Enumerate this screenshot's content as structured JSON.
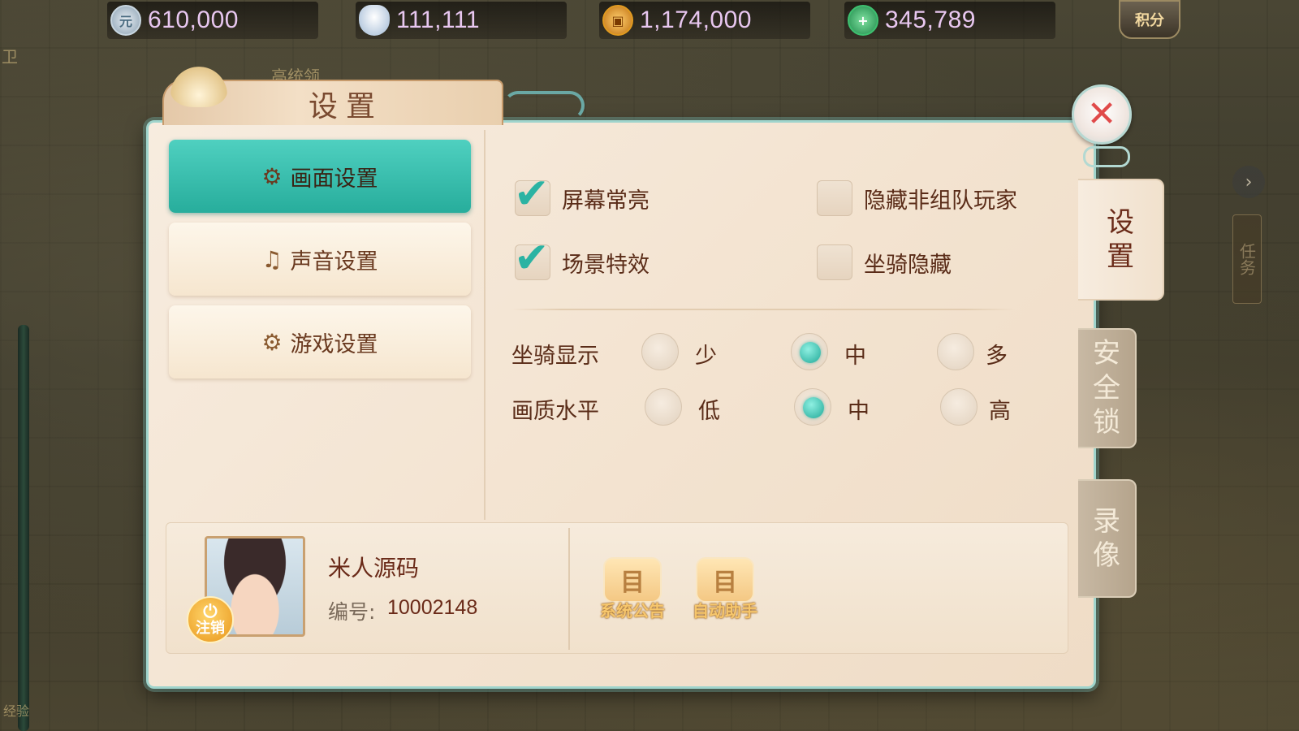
{
  "topbar": {
    "currencies": [
      {
        "icon": "yuan-coin-icon",
        "glyph": "元",
        "value": "610,000"
      },
      {
        "icon": "silver-ingot-icon",
        "glyph": "",
        "value": "111,111"
      },
      {
        "icon": "copper-coin-icon",
        "glyph": "▣",
        "value": "1,174,000"
      },
      {
        "icon": "jade-plus-icon",
        "glyph": "+",
        "value": "345,789"
      }
    ],
    "points_label": "积分"
  },
  "scene": {
    "npc_label": "高统领",
    "left_edge_glyph": "卫",
    "bottom_left_tag": "经验"
  },
  "dialog": {
    "title": "设置",
    "close_glyph": "✕"
  },
  "menu": {
    "items": [
      {
        "label": "画面设置",
        "icon_glyph": "⚙",
        "active": true
      },
      {
        "label": "声音设置",
        "icon_glyph": "♫",
        "active": false
      },
      {
        "label": "游戏设置",
        "icon_glyph": "⚙",
        "active": false
      }
    ]
  },
  "display_settings": {
    "checkboxes": [
      {
        "label": "屏幕常亮",
        "checked": true
      },
      {
        "label": "隐藏非组队玩家",
        "checked": false
      },
      {
        "label": "场景特效",
        "checked": true
      },
      {
        "label": "坐骑隐藏",
        "checked": false
      }
    ],
    "mount_display": {
      "label": "坐骑显示",
      "options": [
        "少",
        "中",
        "多"
      ],
      "selected": "中"
    },
    "quality_level": {
      "label": "画质水平",
      "options": [
        "低",
        "中",
        "高"
      ],
      "selected": "中"
    },
    "tick_glyph": "✔"
  },
  "profile": {
    "name": "米人源码",
    "id_label": "编号:",
    "id_value": "10002148",
    "logout_label": "注销",
    "logout_glyph": "⏻"
  },
  "tools": [
    {
      "label": "系统公告",
      "glyph": "目"
    },
    {
      "label": "自动助手",
      "glyph": "目"
    }
  ],
  "side_tabs": [
    {
      "label": "设置",
      "chars": [
        "设",
        "置"
      ],
      "active": true
    },
    {
      "label": "安全锁",
      "chars": [
        "安",
        "全",
        "锁"
      ],
      "active": false
    },
    {
      "label": "录像",
      "chars": [
        "录",
        "像"
      ],
      "active": false
    }
  ],
  "right_edge": {
    "quest_label": "任务",
    "arrow_glyph": "›"
  }
}
